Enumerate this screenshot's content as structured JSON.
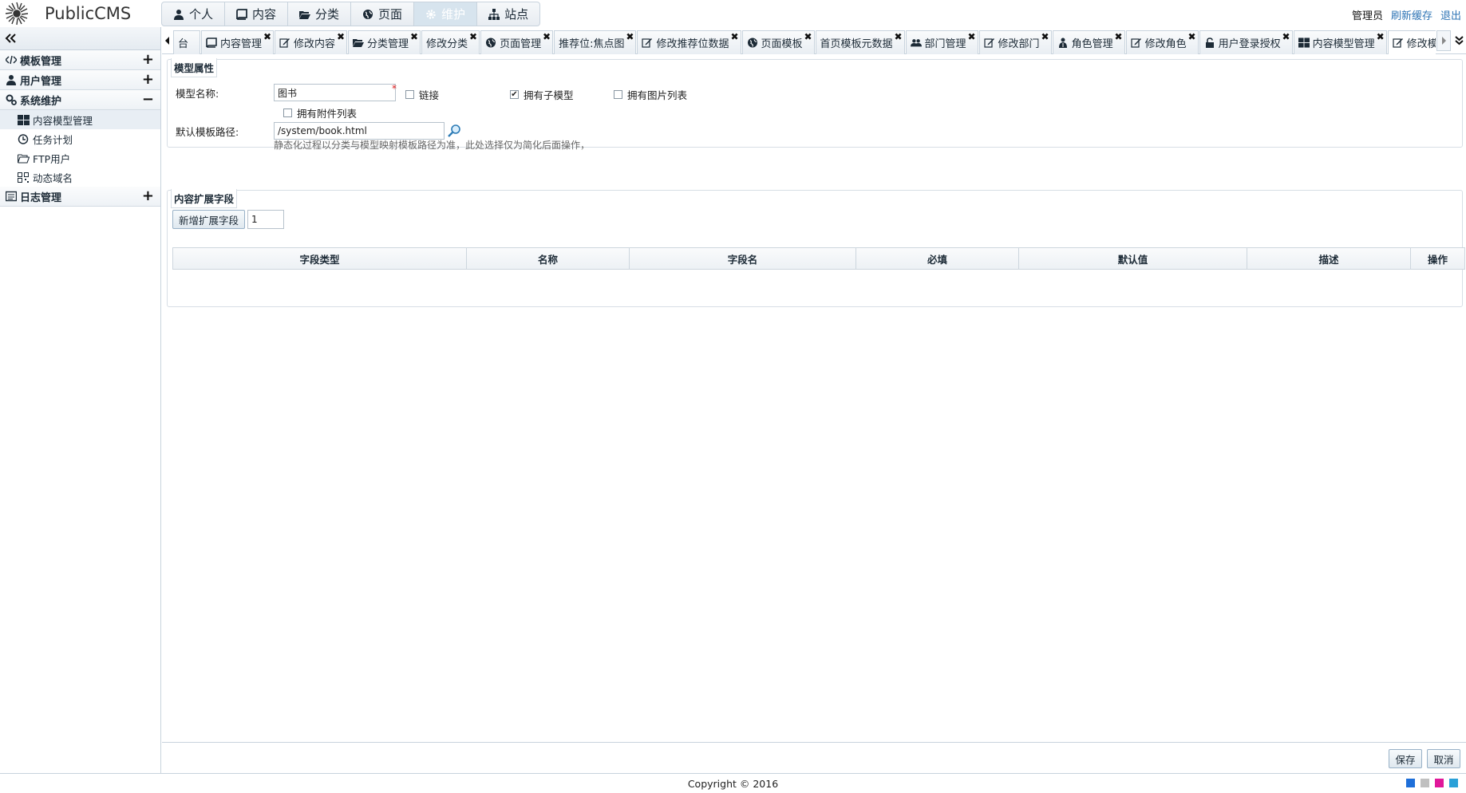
{
  "app": {
    "logo_text": "PublicCMS"
  },
  "topnav": [
    {
      "label": "个人",
      "icon": "user-icon",
      "active": false
    },
    {
      "label": "内容",
      "icon": "book-icon",
      "active": false
    },
    {
      "label": "分类",
      "icon": "folder-icon",
      "active": false
    },
    {
      "label": "页面",
      "icon": "globe-icon",
      "active": false
    },
    {
      "label": "维护",
      "icon": "gear-icon",
      "active": true
    },
    {
      "label": "站点",
      "icon": "sitemap-icon",
      "active": false
    }
  ],
  "user": {
    "name": "管理员",
    "refresh_cache": "刷新缓存",
    "logout": "退出"
  },
  "sidebar": {
    "sections": [
      {
        "label": "模板管理",
        "icon": "code-icon",
        "toggle": "+"
      },
      {
        "label": "用户管理",
        "icon": "user-icon",
        "toggle": "+"
      },
      {
        "label": "系统维护",
        "icon": "cogs-icon",
        "toggle": "−"
      },
      {
        "label": "日志管理",
        "icon": "list-icon",
        "toggle": "+"
      }
    ],
    "system_items": [
      {
        "label": "内容模型管理",
        "icon": "grid-icon",
        "active": true
      },
      {
        "label": "任务计划",
        "icon": "clock-icon",
        "active": false
      },
      {
        "label": "FTP用户",
        "icon": "folder-open-icon",
        "active": false
      },
      {
        "label": "动态域名",
        "icon": "qrcode-icon",
        "active": false
      }
    ]
  },
  "tabs": [
    {
      "label": "台",
      "icon": "",
      "active": false,
      "closable": false
    },
    {
      "label": "内容管理",
      "icon": "book-icon",
      "active": false,
      "closable": true
    },
    {
      "label": "修改内容",
      "icon": "edit-icon",
      "active": false,
      "closable": true
    },
    {
      "label": "分类管理",
      "icon": "folder-icon",
      "active": false,
      "closable": true
    },
    {
      "label": "修改分类",
      "icon": "",
      "active": false,
      "closable": true
    },
    {
      "label": "页面管理",
      "icon": "globe-icon",
      "active": false,
      "closable": true
    },
    {
      "label": "推荐位:焦点图",
      "icon": "",
      "active": false,
      "closable": true
    },
    {
      "label": "修改推荐位数据",
      "icon": "edit-icon",
      "active": false,
      "closable": true
    },
    {
      "label": "页面模板",
      "icon": "globe-icon",
      "active": false,
      "closable": true
    },
    {
      "label": "首页模板元数据",
      "icon": "",
      "active": false,
      "closable": true
    },
    {
      "label": "部门管理",
      "icon": "users-icon",
      "active": false,
      "closable": true
    },
    {
      "label": "修改部门",
      "icon": "edit-icon",
      "active": false,
      "closable": true
    },
    {
      "label": "角色管理",
      "icon": "role-icon",
      "active": false,
      "closable": true
    },
    {
      "label": "修改角色",
      "icon": "edit-icon",
      "active": false,
      "closable": true
    },
    {
      "label": "用户登录授权",
      "icon": "lock-icon",
      "active": false,
      "closable": true
    },
    {
      "label": "内容模型管理",
      "icon": "grid-icon",
      "active": false,
      "closable": true
    },
    {
      "label": "修改模型",
      "icon": "edit-icon",
      "active": true,
      "closable": true
    }
  ],
  "form": {
    "section_model": "模型属性",
    "model_name_label": "模型名称:",
    "model_name_value": "图书",
    "required_mark": "*",
    "chk_link": {
      "label": "链接",
      "checked": false
    },
    "chk_has_child": {
      "label": "拥有子模型",
      "checked": true
    },
    "chk_has_images": {
      "label": "拥有图片列表",
      "checked": false
    },
    "chk_has_files": {
      "label": "拥有附件列表",
      "checked": false
    },
    "template_path_label": "默认模板路径:",
    "template_path_value": "/system/book.html",
    "template_hint": "静态化过程以分类与模型映射模板路径为准，此处选择仅为简化后面操作，",
    "section_ext": "内容扩展字段",
    "add_field_button": "新增扩展字段",
    "add_field_count": "1",
    "columns": [
      "字段类型",
      "名称",
      "字段名",
      "必填",
      "默认值",
      "描述",
      "操作"
    ]
  },
  "actions": {
    "save": "保存",
    "cancel": "取消"
  },
  "footer": {
    "copyright": "Copyright © 2016"
  },
  "themes": [
    "#1e6fd9",
    "#c0c0c0",
    "#e0189a",
    "#2aa0d8"
  ]
}
